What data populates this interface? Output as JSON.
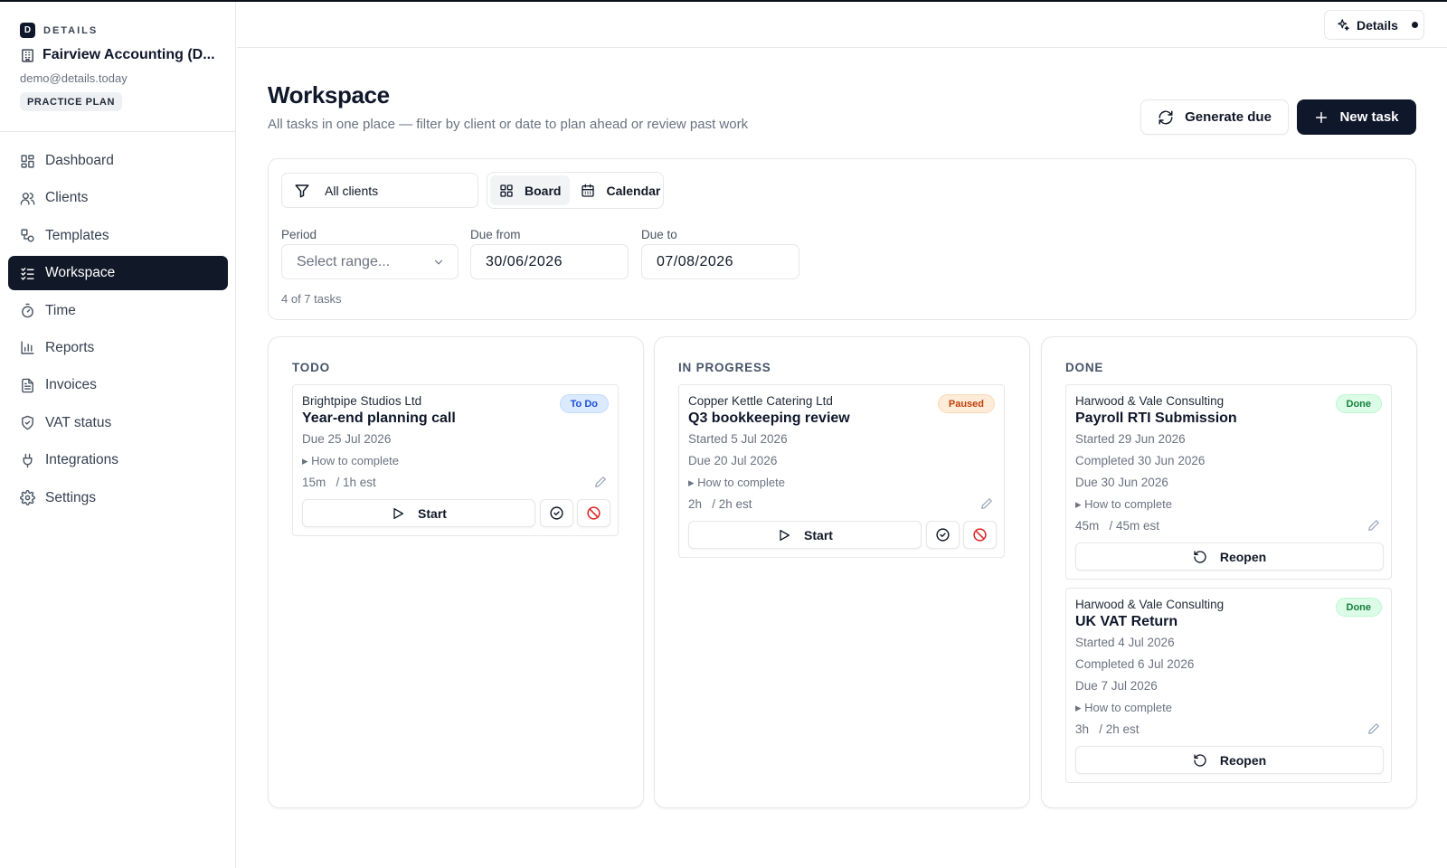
{
  "brand": {
    "logo_letter": "D",
    "name": "DETAILS"
  },
  "org": {
    "name": "Fairview Accounting (D...",
    "email": "demo@details.today",
    "plan": "PRACTICE PLAN"
  },
  "nav": [
    {
      "label": "Dashboard",
      "icon": "grid-icon"
    },
    {
      "label": "Clients",
      "icon": "users-icon"
    },
    {
      "label": "Templates",
      "icon": "shapes-icon"
    },
    {
      "label": "Workspace",
      "icon": "checklist-icon",
      "active": true
    },
    {
      "label": "Time",
      "icon": "stopwatch-icon"
    },
    {
      "label": "Reports",
      "icon": "bar-chart-icon"
    },
    {
      "label": "Invoices",
      "icon": "file-text-icon"
    },
    {
      "label": "VAT status",
      "icon": "shield-check-icon"
    },
    {
      "label": "Integrations",
      "icon": "plug-icon"
    },
    {
      "label": "Settings",
      "icon": "gear-icon"
    }
  ],
  "topbar": {
    "details_label": "Details"
  },
  "header": {
    "title": "Workspace",
    "subtitle": "All tasks in one place — filter by client or date to plan ahead or review past work",
    "generate_label": "Generate due",
    "new_task_label": "New task"
  },
  "filters": {
    "client": "All clients",
    "views": {
      "board": "Board",
      "calendar": "Calendar",
      "active": "Board"
    },
    "period_label": "Period",
    "period_placeholder": "Select range...",
    "due_from_label": "Due from",
    "due_from": "30/06/2026",
    "due_to_label": "Due to",
    "due_to": "07/08/2026",
    "count": "4 of 7 tasks"
  },
  "columns": [
    {
      "title": "TODO",
      "cards": [
        {
          "client": "Brightpipe Studios Ltd",
          "task": "Year-end planning call",
          "status": "To Do",
          "lines": [
            "Due 25 Jul 2026"
          ],
          "how": "▸ How to complete",
          "time": "15m   / 1h est",
          "action": "Start"
        }
      ]
    },
    {
      "title": "IN PROGRESS",
      "cards": [
        {
          "client": "Copper Kettle Catering Ltd",
          "task": "Q3 bookkeeping review",
          "status": "Paused",
          "lines": [
            "Started 5 Jul 2026",
            "Due 20 Jul 2026"
          ],
          "how": "▸ How to complete",
          "time": "2h   / 2h est",
          "action": "Start"
        }
      ]
    },
    {
      "title": "DONE",
      "cards": [
        {
          "client": "Harwood & Vale Consulting",
          "task": "Payroll RTI Submission",
          "status": "Done",
          "lines": [
            "Started 29 Jun 2026",
            "Completed 30 Jun 2026",
            "Due 30 Jun 2026"
          ],
          "how": "▸ How to complete",
          "time": "45m   / 45m est",
          "action": "Reopen"
        },
        {
          "client": "Harwood & Vale Consulting",
          "task": "UK VAT Return",
          "status": "Done",
          "lines": [
            "Started 4 Jul 2026",
            "Completed 6 Jul 2026",
            "Due 7 Jul 2026"
          ],
          "how": "▸ How to complete",
          "time": "3h   / 2h est",
          "action": "Reopen"
        }
      ]
    }
  ],
  "colors": {
    "primary": "#0f172a",
    "todo_badge": "#dbeafe",
    "paused_badge": "#fdecd8",
    "done_badge": "#dcfce7",
    "danger": "#dc2626"
  }
}
